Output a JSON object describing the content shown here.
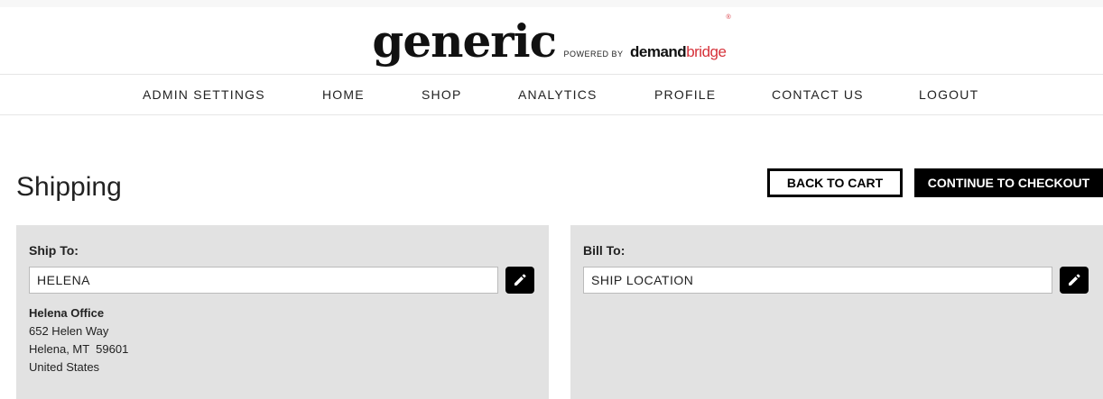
{
  "header": {
    "logo_word": "generic",
    "logo_powered": "POWERED BY",
    "logo_demand": "demand",
    "logo_bridge": "bridge",
    "logo_reg": "®"
  },
  "nav": {
    "items": [
      {
        "label": "ADMIN SETTINGS"
      },
      {
        "label": "HOME"
      },
      {
        "label": "SHOP"
      },
      {
        "label": "ANALYTICS"
      },
      {
        "label": "PROFILE"
      },
      {
        "label": "CONTACT US"
      },
      {
        "label": "LOGOUT"
      }
    ]
  },
  "page": {
    "title": "Shipping",
    "back_label": "BACK TO CART",
    "continue_label": "CONTINUE TO CHECKOUT"
  },
  "ship_to": {
    "label": "Ship To:",
    "value": "HELENA",
    "edit_icon": "pencil-icon",
    "address": {
      "name": "Helena Office",
      "street": "652 Helen Way",
      "city": "Helena, MT  59601",
      "country": "United States"
    }
  },
  "bill_to": {
    "label": "Bill To:",
    "value": "SHIP LOCATION",
    "edit_icon": "pencil-icon"
  },
  "colors": {
    "accent": "#000000",
    "brand_red": "#d6323a",
    "panel_bg": "#e2e2e2"
  }
}
